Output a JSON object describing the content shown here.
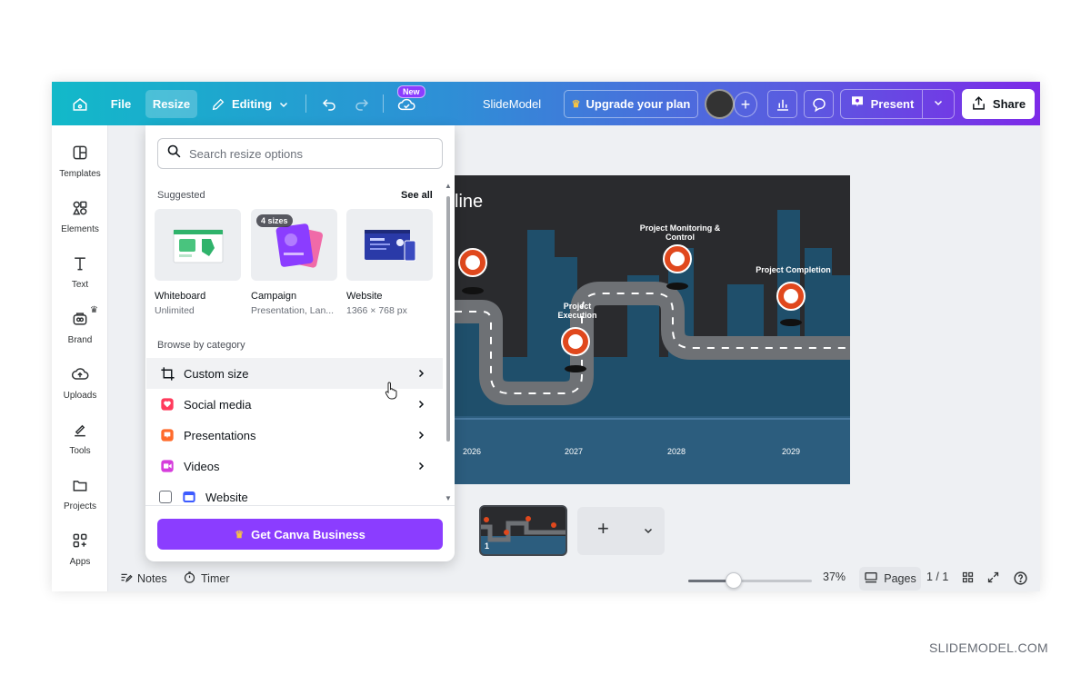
{
  "topbar": {
    "home_icon": "home-icon",
    "file_label": "File",
    "resize_label": "Resize",
    "editing_label": "Editing",
    "new_badge": "New",
    "doc_title": "SlideModel",
    "upgrade_label": "Upgrade your plan",
    "present_label": "Present",
    "share_label": "Share"
  },
  "sidebar": {
    "items": [
      {
        "label": "Templates",
        "icon": "templates-icon"
      },
      {
        "label": "Elements",
        "icon": "elements-icon"
      },
      {
        "label": "Text",
        "icon": "text-icon"
      },
      {
        "label": "Brand",
        "icon": "brand-icon"
      },
      {
        "label": "Uploads",
        "icon": "uploads-icon"
      },
      {
        "label": "Tools",
        "icon": "tools-icon"
      },
      {
        "label": "Projects",
        "icon": "projects-icon"
      },
      {
        "label": "Apps",
        "icon": "apps-icon"
      }
    ]
  },
  "resize_panel": {
    "search_placeholder": "Search resize options",
    "suggested_title": "Suggested",
    "see_all": "See all",
    "suggested": [
      {
        "title": "Whiteboard",
        "subtitle": "Unlimited"
      },
      {
        "title": "Campaign",
        "subtitle": "Presentation, Lan...",
        "badge": "4 sizes"
      },
      {
        "title": "Website",
        "subtitle": "1366 × 768 px"
      }
    ],
    "browse_title": "Browse by category",
    "categories": [
      {
        "label": "Custom size"
      },
      {
        "label": "Social media"
      },
      {
        "label": "Presentations"
      },
      {
        "label": "Videos"
      },
      {
        "label": "Website"
      }
    ],
    "cta_label": "Get Canva Business"
  },
  "slide": {
    "title_fragment": "line",
    "milestones": {
      "monitoring": "Project Monitoring & Control",
      "execution": "Project Execution",
      "completion": "Project Completion"
    },
    "years": [
      "2026",
      "2027",
      "2028",
      "2029"
    ]
  },
  "thumbnails": {
    "page_number": "1"
  },
  "bottombar": {
    "notes_label": "Notes",
    "timer_label": "Timer",
    "zoom_value": "37%",
    "zoom_level": 0.37,
    "pages_label": "Pages",
    "page_count": "1 / 1"
  },
  "watermark": "SLIDEMODEL.COM",
  "colors": {
    "accent": "#8b3dff",
    "topbar_start": "#12b9c9",
    "topbar_end": "#7d2ae8",
    "pin": "#e0481d"
  }
}
